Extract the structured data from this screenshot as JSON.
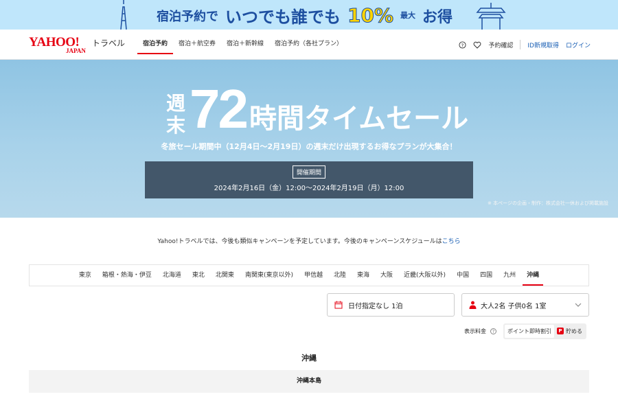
{
  "promo": {
    "text1": "宿泊予約で",
    "text2": "いつでも誰でも",
    "percent": "10%",
    "max": "最大",
    "text4": "お得"
  },
  "header": {
    "logo_main": "YAHOO!",
    "logo_sub": "JAPAN",
    "logo_service": "トラベル",
    "nav": [
      {
        "label": "宿泊予約",
        "active": true
      },
      {
        "label": "宿泊＋航空券",
        "active": false
      },
      {
        "label": "宿泊＋新幹線",
        "active": false
      },
      {
        "label": "宿泊予約（各社プラン）",
        "active": false
      }
    ],
    "reservation_check": "予約確認",
    "register": "ID新規取得",
    "login": "ログイン"
  },
  "hero": {
    "weekend": "週末",
    "hours": "72",
    "title_rest": "時間タイムセール",
    "subtitle": "冬旅セール期間中（12月4日～2月19日）の週末だけ出現するお得なプランが大集合！",
    "period_label": "開催期間",
    "period_dates": "2024年2月16日（金）12:00～2024年2月19日（月）12:00",
    "note": "※ 本ページの企画・制作：株式会社一休および掲載施設"
  },
  "notice": {
    "text": "Yahoo!トラベルでは、今後も類似キャンペーンを予定しています。今後のキャンペーンスケジュールは",
    "link": "こちら"
  },
  "regions": [
    {
      "label": "東京",
      "active": false
    },
    {
      "label": "箱根・熱海・伊豆",
      "active": false
    },
    {
      "label": "北海道",
      "active": false
    },
    {
      "label": "東北",
      "active": false
    },
    {
      "label": "北関東",
      "active": false
    },
    {
      "label": "南関東(東京以外)",
      "active": false
    },
    {
      "label": "甲信越",
      "active": false
    },
    {
      "label": "北陸",
      "active": false
    },
    {
      "label": "東海",
      "active": false
    },
    {
      "label": "大阪",
      "active": false
    },
    {
      "label": "近畿(大阪以外)",
      "active": false
    },
    {
      "label": "中国",
      "active": false
    },
    {
      "label": "四国",
      "active": false
    },
    {
      "label": "九州",
      "active": false
    },
    {
      "label": "沖縄",
      "active": true
    }
  ],
  "search": {
    "date": "日付指定なし 1泊",
    "guests": "大人2名 子供0名 1室"
  },
  "price": {
    "label": "表示料金",
    "opt1": "ポイント即時割引",
    "opt2": "貯める"
  },
  "area": {
    "title": "沖縄",
    "subarea": "沖縄本島"
  },
  "colors": {
    "brand_red": "#e60012",
    "link_blue": "#1a5fb4",
    "period_bg": "#43576a"
  }
}
